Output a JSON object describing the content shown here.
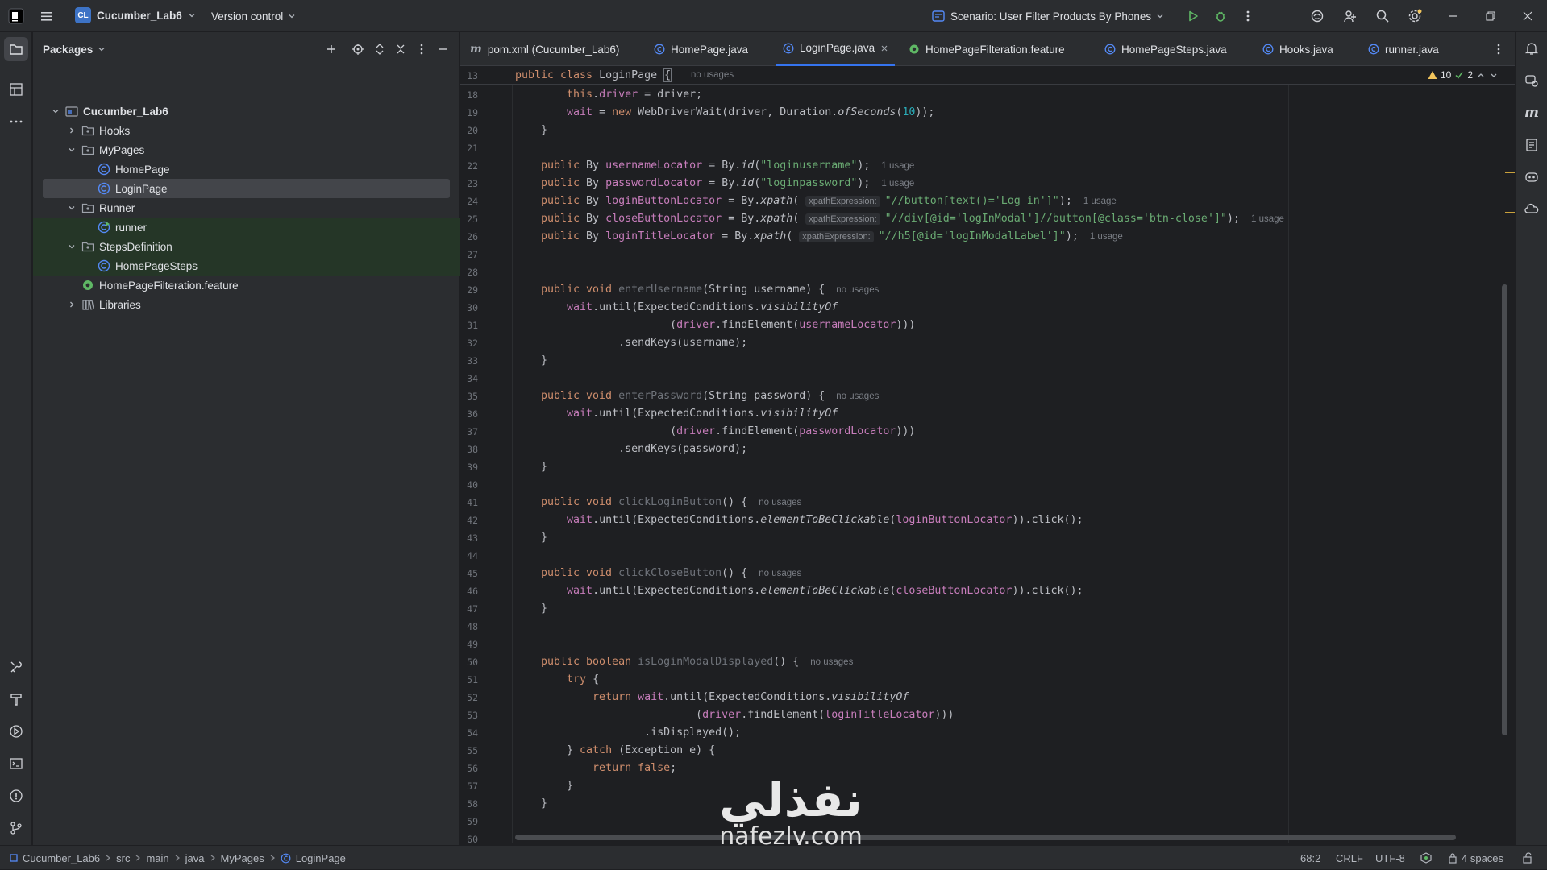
{
  "titlebar": {
    "project_badge": "CL",
    "project_name": "Cucumber_Lab6",
    "version_control": "Version control",
    "run_config": "Scenario: User Filter Products By Phones"
  },
  "project_panel": {
    "title": "Packages",
    "tree": [
      {
        "label": "Cucumber_Lab6",
        "depth": 0,
        "kind": "module",
        "expanded": true
      },
      {
        "label": "Hooks",
        "depth": 1,
        "kind": "package",
        "expanded": false
      },
      {
        "label": "MyPages",
        "depth": 1,
        "kind": "package",
        "expanded": true
      },
      {
        "label": "HomePage",
        "depth": 2,
        "kind": "class"
      },
      {
        "label": "LoginPage",
        "depth": 2,
        "kind": "class",
        "selected": true
      },
      {
        "label": "Runner",
        "depth": 1,
        "kind": "package",
        "expanded": true
      },
      {
        "label": "runner",
        "depth": 2,
        "kind": "class-runnable"
      },
      {
        "label": "StepsDefinition",
        "depth": 1,
        "kind": "package",
        "expanded": true
      },
      {
        "label": "HomePageSteps",
        "depth": 2,
        "kind": "class"
      },
      {
        "label": "HomePageFilteration.feature",
        "depth": 1,
        "kind": "feature"
      },
      {
        "label": "Libraries",
        "depth": 1,
        "kind": "libraries",
        "expanded": false
      }
    ]
  },
  "tabs": [
    {
      "label": "pom.xml (Cucumber_Lab6)",
      "icon": "maven-icon"
    },
    {
      "label": "HomePage.java",
      "icon": "java-class-icon"
    },
    {
      "label": "LoginPage.java",
      "icon": "java-class-icon",
      "active": true,
      "closable": true
    },
    {
      "label": "HomePageFilteration.feature",
      "icon": "feature-icon"
    },
    {
      "label": "HomePageSteps.java",
      "icon": "java-class-icon"
    },
    {
      "label": "Hooks.java",
      "icon": "java-class-icon"
    },
    {
      "label": "runner.java",
      "icon": "java-class-icon"
    }
  ],
  "inspections": {
    "warnings": "10",
    "ok": "2"
  },
  "sticky_line": {
    "num": "13",
    "text": "public class LoginPage {",
    "hint": "no usages"
  },
  "code_lines": [
    {
      "n": "18",
      "s": [
        [
          "    ",
          ""
        ],
        [
          "this",
          ".kw"
        ],
        [
          ".",
          ""
        ],
        [
          "driver",
          "fd"
        ],
        [
          " = driver;",
          ""
        ]
      ]
    },
    {
      "n": "19",
      "s": [
        [
          "    ",
          ""
        ],
        [
          "wait",
          "fd"
        ],
        [
          " = ",
          ""
        ],
        [
          "new ",
          "kw"
        ],
        [
          "WebDriverWait(driver, Duration.",
          ""
        ],
        [
          "ofSeconds",
          "it"
        ],
        [
          "(",
          ""
        ],
        [
          "10",
          "nu"
        ],
        [
          "));",
          ""
        ]
      ]
    },
    {
      "n": "20",
      "s": [
        [
          "}",
          ""
        ]
      ]
    },
    {
      "n": "21",
      "s": []
    },
    {
      "n": "22",
      "s": [
        [
          "public ",
          "kw"
        ],
        [
          "By ",
          ""
        ],
        [
          "usernameLocator",
          "fd"
        ],
        [
          " = By.",
          ""
        ],
        [
          "id",
          "it"
        ],
        [
          "(",
          ""
        ],
        [
          "\"loginusername\"",
          "st"
        ],
        [
          ");",
          ""
        ]
      ],
      "h": "1 usage"
    },
    {
      "n": "23",
      "s": [
        [
          "public ",
          "kw"
        ],
        [
          "By ",
          ""
        ],
        [
          "passwordLocator",
          "fd"
        ],
        [
          " = By.",
          ""
        ],
        [
          "id",
          "it"
        ],
        [
          "(",
          ""
        ],
        [
          "\"loginpassword\"",
          "st"
        ],
        [
          ");",
          ""
        ]
      ],
      "h": "1 usage"
    },
    {
      "n": "24",
      "s": [
        [
          "public ",
          "kw"
        ],
        [
          "By ",
          ""
        ],
        [
          "loginButtonLocator",
          "fd"
        ],
        [
          " = By.",
          ""
        ],
        [
          "xpath",
          "it"
        ],
        [
          "( ",
          ""
        ],
        [
          "xpathExpression:",
          "chip"
        ],
        [
          "\"//button[text()='Log in']\"",
          "st"
        ],
        [
          ");",
          ""
        ]
      ],
      "h": "1 usage"
    },
    {
      "n": "25",
      "s": [
        [
          "public ",
          "kw"
        ],
        [
          "By ",
          ""
        ],
        [
          "closeButtonLocator",
          "fd"
        ],
        [
          " = By.",
          ""
        ],
        [
          "xpath",
          "it"
        ],
        [
          "( ",
          ""
        ],
        [
          "xpathExpression:",
          "chip"
        ],
        [
          "\"//div[@id='logInModal']//button[@class='btn-close']\"",
          "st"
        ],
        [
          ");",
          ""
        ]
      ],
      "h": "1 usage"
    },
    {
      "n": "26",
      "s": [
        [
          "public ",
          "kw"
        ],
        [
          "By ",
          ""
        ],
        [
          "loginTitleLocator",
          "fd"
        ],
        [
          " = By.",
          ""
        ],
        [
          "xpath",
          "it"
        ],
        [
          "( ",
          ""
        ],
        [
          "xpathExpression:",
          "chip"
        ],
        [
          "\"//h5[@id='logInModalLabel']\"",
          "st"
        ],
        [
          ");",
          ""
        ]
      ],
      "h": "1 usage"
    },
    {
      "n": "27",
      "s": []
    },
    {
      "n": "28",
      "s": []
    },
    {
      "n": "29",
      "s": [
        [
          "public void ",
          "kw"
        ],
        [
          "enterUsername",
          "dim"
        ],
        [
          "(String username) {",
          ""
        ]
      ],
      "h": "no usages"
    },
    {
      "n": "30",
      "s": [
        [
          "    ",
          ""
        ],
        [
          "wait",
          "fd"
        ],
        [
          ".until(ExpectedConditions.",
          ""
        ],
        [
          "visibilityOf",
          "it"
        ]
      ]
    },
    {
      "n": "31",
      "s": [
        [
          "                    (",
          ""
        ],
        [
          "driver",
          "fd"
        ],
        [
          ".findElement(",
          ""
        ],
        [
          "usernameLocator",
          "fd"
        ],
        [
          ")))",
          ""
        ]
      ]
    },
    {
      "n": "32",
      "s": [
        [
          "            .sendKeys(username);",
          ""
        ]
      ]
    },
    {
      "n": "33",
      "s": [
        [
          "}",
          ""
        ]
      ]
    },
    {
      "n": "34",
      "s": []
    },
    {
      "n": "35",
      "s": [
        [
          "public void ",
          "kw"
        ],
        [
          "enterPassword",
          "dim"
        ],
        [
          "(String password) {",
          ""
        ]
      ],
      "h": "no usages"
    },
    {
      "n": "36",
      "s": [
        [
          "    ",
          ""
        ],
        [
          "wait",
          "fd"
        ],
        [
          ".until(ExpectedConditions.",
          ""
        ],
        [
          "visibilityOf",
          "it"
        ]
      ]
    },
    {
      "n": "37",
      "s": [
        [
          "                    (",
          ""
        ],
        [
          "driver",
          "fd"
        ],
        [
          ".findElement(",
          ""
        ],
        [
          "passwordLocator",
          "fd"
        ],
        [
          ")))",
          ""
        ]
      ]
    },
    {
      "n": "38",
      "s": [
        [
          "            .sendKeys(password);",
          ""
        ]
      ]
    },
    {
      "n": "39",
      "s": [
        [
          "}",
          ""
        ]
      ]
    },
    {
      "n": "40",
      "s": []
    },
    {
      "n": "41",
      "s": [
        [
          "public void ",
          "kw"
        ],
        [
          "clickLoginButton",
          "dim"
        ],
        [
          "() {",
          ""
        ]
      ],
      "h": "no usages"
    },
    {
      "n": "42",
      "s": [
        [
          "    ",
          ""
        ],
        [
          "wait",
          "fd"
        ],
        [
          ".until(ExpectedConditions.",
          ""
        ],
        [
          "elementToBeClickable",
          "it"
        ],
        [
          "(",
          ""
        ],
        [
          "loginButtonLocator",
          "fd"
        ],
        [
          ")).click();",
          ""
        ]
      ]
    },
    {
      "n": "43",
      "s": [
        [
          "}",
          ""
        ]
      ]
    },
    {
      "n": "44",
      "s": []
    },
    {
      "n": "45",
      "s": [
        [
          "public void ",
          "kw"
        ],
        [
          "clickCloseButton",
          "dim"
        ],
        [
          "() {",
          ""
        ]
      ],
      "h": "no usages"
    },
    {
      "n": "46",
      "s": [
        [
          "    ",
          ""
        ],
        [
          "wait",
          "fd"
        ],
        [
          ".until(ExpectedConditions.",
          ""
        ],
        [
          "elementToBeClickable",
          "it"
        ],
        [
          "(",
          ""
        ],
        [
          "closeButtonLocator",
          "fd"
        ],
        [
          ")).click();",
          ""
        ]
      ]
    },
    {
      "n": "47",
      "s": [
        [
          "}",
          ""
        ]
      ]
    },
    {
      "n": "48",
      "s": []
    },
    {
      "n": "49",
      "s": []
    },
    {
      "n": "50",
      "s": [
        [
          "public boolean ",
          "kw"
        ],
        [
          "isLoginModalDisplayed",
          "dim"
        ],
        [
          "() {",
          ""
        ]
      ],
      "h": "no usages"
    },
    {
      "n": "51",
      "s": [
        [
          "    ",
          ""
        ],
        [
          "try ",
          "kw"
        ],
        [
          "{",
          ""
        ]
      ]
    },
    {
      "n": "52",
      "s": [
        [
          "        ",
          ""
        ],
        [
          "return ",
          "kw"
        ],
        [
          "wait",
          "fd"
        ],
        [
          ".until(ExpectedConditions.",
          ""
        ],
        [
          "visibilityOf",
          "it"
        ]
      ]
    },
    {
      "n": "53",
      "s": [
        [
          "                        (",
          ""
        ],
        [
          "driver",
          "fd"
        ],
        [
          ".findElement(",
          ""
        ],
        [
          "loginTitleLocator",
          "fd"
        ],
        [
          ")))",
          ""
        ]
      ]
    },
    {
      "n": "54",
      "s": [
        [
          "                .isDisplayed();",
          ""
        ]
      ]
    },
    {
      "n": "55",
      "s": [
        [
          "    } ",
          ""
        ],
        [
          "catch ",
          "kw"
        ],
        [
          "(Exception e) {",
          ""
        ]
      ]
    },
    {
      "n": "56",
      "s": [
        [
          "        ",
          ""
        ],
        [
          "return false",
          "kw"
        ],
        [
          ";",
          ""
        ]
      ]
    },
    {
      "n": "57",
      "s": [
        [
          "    }",
          ""
        ]
      ]
    },
    {
      "n": "58",
      "s": [
        [
          "}",
          ""
        ]
      ]
    },
    {
      "n": "59",
      "s": []
    },
    {
      "n": "60",
      "s": []
    }
  ],
  "watermark": {
    "arabic": "نفذلي",
    "latin": "nafezly.com"
  },
  "breadcrumbs": [
    "Cucumber_Lab6",
    "src",
    "main",
    "java",
    "MyPages",
    "LoginPage"
  ],
  "status": {
    "position": "68:2",
    "line_ending": "CRLF",
    "encoding": "UTF-8",
    "indent": "4 spaces"
  },
  "colors": {
    "accent": "#3574f0",
    "keyword": "#cf8e6d",
    "string": "#6aab73",
    "field": "#c77dbb",
    "number": "#2aacb8",
    "method": "#56a8f5"
  }
}
